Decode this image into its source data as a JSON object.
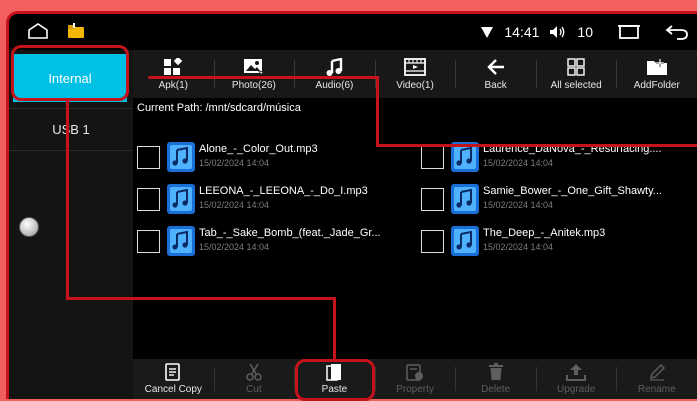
{
  "status": {
    "time": "14:41",
    "volume": "10"
  },
  "sidebar": {
    "internal_label": "Internal",
    "usb_label": "USB 1"
  },
  "toolbar": [
    {
      "label": "Apk(1)",
      "icon": "apps-icon"
    },
    {
      "label": "Photo(26)",
      "icon": "photo-icon"
    },
    {
      "label": "Audio(6)",
      "icon": "music-note-icon"
    },
    {
      "label": "Video(1)",
      "icon": "film-icon"
    },
    {
      "label": "Back",
      "icon": "back-arrow-icon"
    },
    {
      "label": "All selected",
      "icon": "grid-icon"
    },
    {
      "label": "AddFolder",
      "icon": "add-folder-icon"
    }
  ],
  "content": {
    "path": "Current Path: /mnt/sdcard/música",
    "files": [
      {
        "name": "Alone_-_Color_Out.mp3",
        "date": "15/02/2024 14:04"
      },
      {
        "name": "Laurence_DaNova_-_Resurfacing....",
        "date": "15/02/2024 14:04"
      },
      {
        "name": "LEEONA_-_LEEONA_-_Do_I.mp3",
        "date": "15/02/2024 14:04"
      },
      {
        "name": "Samie_Bower_-_One_Gift_Shawty...",
        "date": "15/02/2024 14:04"
      },
      {
        "name": "Tab_-_Sake_Bomb_(feat._Jade_Gr...",
        "date": "15/02/2024 14:04"
      },
      {
        "name": "The_Deep_-_Anitek.mp3",
        "date": "15/02/2024 14:04"
      }
    ]
  },
  "bottombar": [
    {
      "label": "Cancel Copy",
      "enabled": true
    },
    {
      "label": "Cut",
      "enabled": false
    },
    {
      "label": "Paste",
      "enabled": true
    },
    {
      "label": "Property",
      "enabled": false
    },
    {
      "label": "Delete",
      "enabled": false
    },
    {
      "label": "Upgrade",
      "enabled": false
    },
    {
      "label": "Rename",
      "enabled": false
    }
  ],
  "colors": {
    "accent": "#00c0e6",
    "highlight": "#c4131b",
    "background": "#f25f5c"
  }
}
